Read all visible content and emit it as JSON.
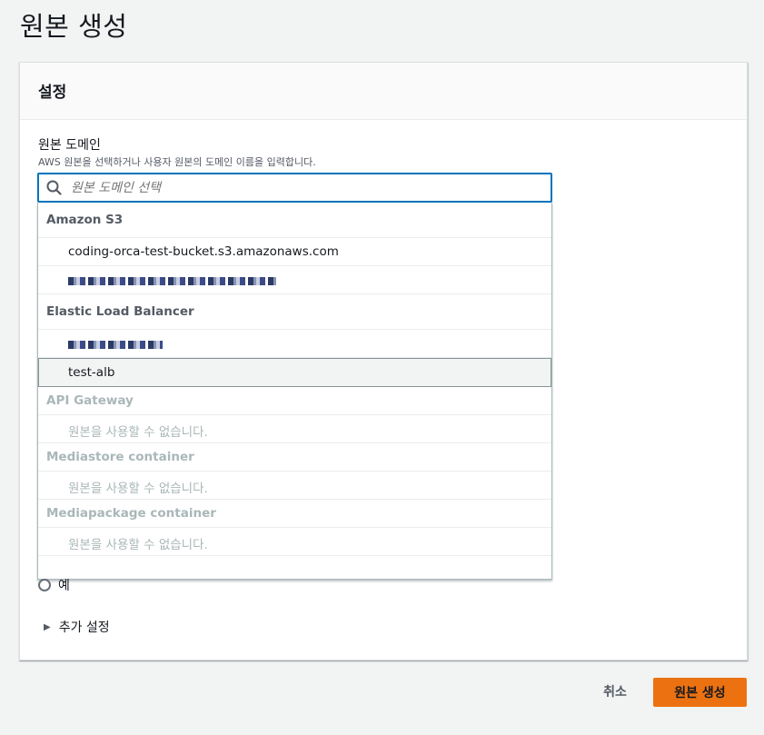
{
  "page": {
    "title": "원본 생성"
  },
  "panel": {
    "title": "설정"
  },
  "origin_domain": {
    "label": "원본 도메인",
    "description": "AWS 원본을 선택하거나 사용자 원본의 도메인 이름을 입력합니다.",
    "placeholder": "원본 도메인 선택"
  },
  "dropdown": {
    "groups": [
      {
        "label": "Amazon S3",
        "options": [
          "coding-orca-test-bucket.s3.amazonaws.com"
        ]
      },
      {
        "label": "Elastic Load Balancer",
        "options": [
          "test-alb"
        ]
      },
      {
        "label": "API Gateway",
        "options": [
          "원본을 사용할 수 없습니다."
        ]
      },
      {
        "label": "Mediastore container",
        "options": [
          "원본을 사용할 수 없습니다."
        ]
      },
      {
        "label": "Mediapackage container",
        "options": [
          "원본을 사용할 수 없습니다."
        ]
      }
    ]
  },
  "radio": {
    "label": "예"
  },
  "expander": {
    "label": "추가 설정"
  },
  "footer": {
    "cancel_label": "취소",
    "create_label": "원본 생성"
  },
  "colors": {
    "accent": "#0073bb",
    "primary_button": "#ec7211",
    "disabled_text": "#aab7b8"
  }
}
